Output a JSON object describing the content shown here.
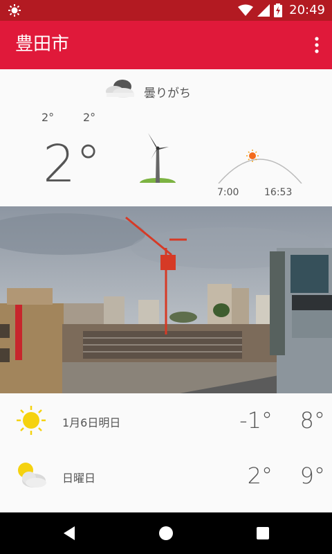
{
  "status_bar": {
    "time": "20:49",
    "icons": [
      "brightness-icon",
      "wifi-icon",
      "signal-icon",
      "battery-charging-icon"
    ]
  },
  "app_bar": {
    "title": "豊田市",
    "menu_icon": "more-vert-icon"
  },
  "current": {
    "condition": "曇りがち",
    "condition_icon": "cloudy-icon",
    "high": "2°",
    "low": "2°",
    "temperature": "2°",
    "wind_icon": "wind-turbine-icon",
    "sunrise": "7:00",
    "sunset": "16:53"
  },
  "photo": {
    "subject": "city-construction-crane-photo"
  },
  "forecast": [
    {
      "label": "1月6日明日",
      "icon": "sunny-icon",
      "low": "-1°",
      "high": "8°"
    },
    {
      "label": "日曜日",
      "icon": "partly-cloudy-icon",
      "low": "2°",
      "high": "9°"
    }
  ],
  "colors": {
    "status_bar": "#b31a22",
    "app_bar": "#e0193a",
    "sun": "#f5d20f"
  }
}
